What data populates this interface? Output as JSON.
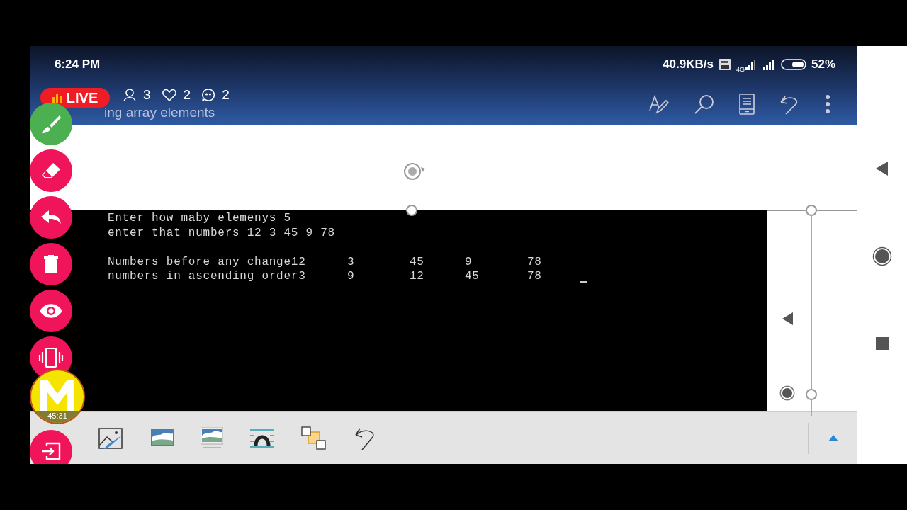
{
  "status_bar": {
    "time": "6:24 PM",
    "network_speed": "40.9KB/s",
    "network_type": "4G",
    "battery": "52%"
  },
  "live_badge": {
    "label": "LIVE"
  },
  "stats": [
    {
      "kind": "viewers",
      "count": "3"
    },
    {
      "kind": "likes",
      "count": "2"
    },
    {
      "kind": "comments",
      "count": "2"
    }
  ],
  "toolbar": {
    "title": "ing array elements"
  },
  "float_buttons": [
    {
      "kind": "brush",
      "color": "#4caf50"
    },
    {
      "kind": "eraser",
      "color": "#f0145a"
    },
    {
      "kind": "undo",
      "color": "#f0145a"
    },
    {
      "kind": "delete",
      "color": "#f0145a"
    },
    {
      "kind": "eye",
      "color": "#f0145a"
    },
    {
      "kind": "vibrate",
      "color": "#f0145a"
    }
  ],
  "recorder": {
    "timer": "45:31"
  },
  "console": {
    "lines": [
      "Enter how maby elemenys 5",
      "enter that numbers 12 3 45 9 78"
    ],
    "rows": [
      {
        "label": "Numbers before any change12",
        "values": [
          "3",
          "45",
          "9",
          "78"
        ]
      },
      {
        "label": "numbers in ascending order3",
        "values": [
          "9",
          "12",
          "45",
          "78"
        ]
      }
    ]
  }
}
